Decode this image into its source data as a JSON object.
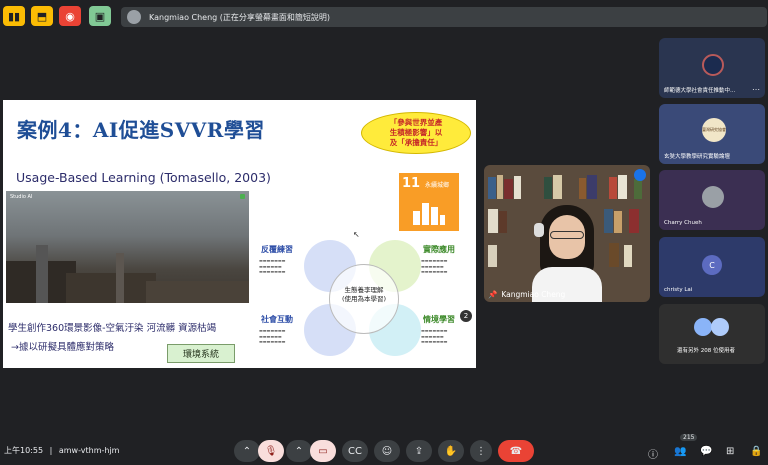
{
  "top": {
    "presenter_banner": "Kangmiao Cheng (正在分享螢幕畫面和簡短說明)"
  },
  "slide": {
    "title": "案例4：AI促進SVVR學習",
    "callout_line1": "「參與世界並產",
    "callout_line2": "生積極影響」以",
    "callout_line3": "及「承擔責任」",
    "subtitle": "Usage-Based Learning (Tomasello, 2003)",
    "sdg_number": "11",
    "sdg_label": "永續城鄉",
    "video_label": "Studio AI",
    "bottom_line1": "學生創作360環景影像-空氣汙染 河流髒 資源枯竭",
    "bottom_line2": "→據以研擬具體應對策略",
    "env_box": "環境系統",
    "center_label_1": "生態養李理解",
    "center_label_2": "(使用為本學習)",
    "quadrants": [
      {
        "label": "反覆練習",
        "color": "#2f4fa8"
      },
      {
        "label": "實際應用",
        "color": "#3d8a2a"
      },
      {
        "label": "社會互動",
        "color": "#2f4fa8"
      },
      {
        "label": "情境學習",
        "color": "#3d8a2a"
      }
    ],
    "pager": "2"
  },
  "presenter": {
    "name": "Kangmiao Cheng"
  },
  "participants": [
    {
      "name": "師範德大學社會責任推動中..."
    },
    {
      "name": "玄奘大學教學研究實驗論壇",
      "avatar_text": "臺灣研究協會"
    },
    {
      "name": "Charry Chueh"
    },
    {
      "name": "christy Lai",
      "initial": "C"
    },
    {
      "name": "還有另外 208 位使用者"
    }
  ],
  "controls": {
    "time": "上午10:55",
    "meeting_code": "amw-vthm-hjm",
    "participant_count": "215"
  }
}
